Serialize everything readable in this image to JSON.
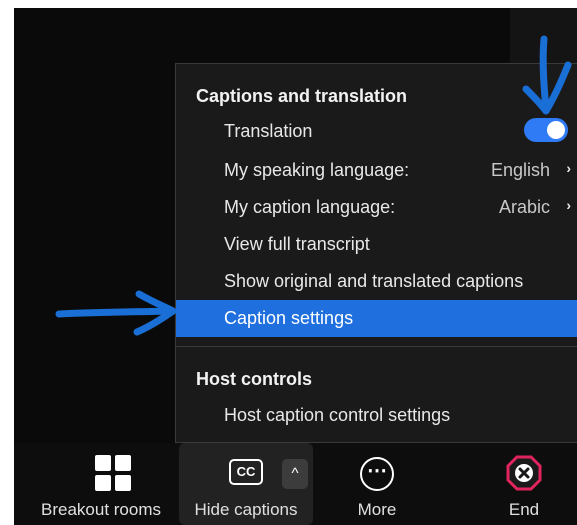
{
  "menu": {
    "captions_heading": "Captions and translation",
    "translation_label": "Translation",
    "translation_enabled": true,
    "speaking_language_label": "My speaking language:",
    "speaking_language_value": "English",
    "caption_language_label": "My caption language:",
    "caption_language_value": "Arabic",
    "view_transcript_label": "View full transcript",
    "show_original_label": "Show original and translated captions",
    "caption_settings_label": "Caption settings",
    "host_heading": "Host controls",
    "host_caption_settings_label": "Host caption control settings"
  },
  "toolbar": {
    "breakout_rooms_label": "Breakout rooms",
    "hide_captions_label": "Hide captions",
    "cc_icon_text": "CC",
    "caret": "^",
    "more_label": "More",
    "end_label": "End"
  },
  "colors": {
    "accent": "#1f6fde",
    "toggle_on": "#2f7bf5",
    "annotation_arrow": "#1a6fd6",
    "end_red": "#e0245e"
  },
  "icons": [
    "grid-icon",
    "closed-captions-icon",
    "chevron-up-icon",
    "more-dots-icon",
    "end-call-icon",
    "chevron-right-icon"
  ]
}
